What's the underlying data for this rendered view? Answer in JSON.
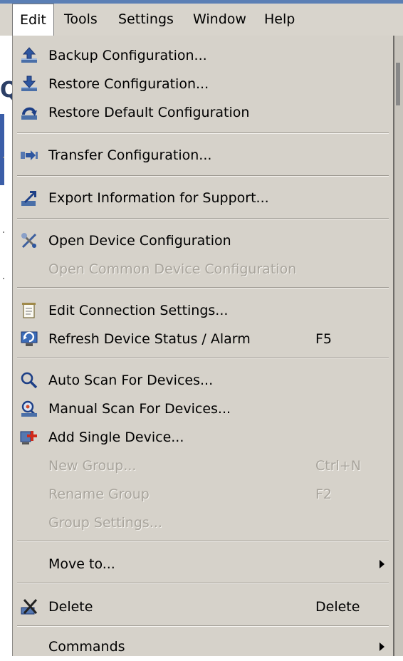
{
  "menubar": {
    "items": [
      "Edit",
      "Tools",
      "Settings",
      "Window",
      "Help"
    ]
  },
  "menu": {
    "items": [
      {
        "label": "Backup Configuration...",
        "icon": "backup-icon"
      },
      {
        "label": "Restore Configuration...",
        "icon": "restore-icon"
      },
      {
        "label": "Restore Default Configuration",
        "icon": "restore-default-icon"
      },
      {
        "label": "Transfer Configuration...",
        "icon": "transfer-icon"
      },
      {
        "label": "Export Information for Support...",
        "icon": "export-icon"
      },
      {
        "label": "Open Device Configuration",
        "icon": "tools-icon"
      },
      {
        "label": "Open Common Device Configuration",
        "disabled": true
      },
      {
        "label": "Edit Connection Settings...",
        "icon": "document-icon"
      },
      {
        "label": "Refresh Device Status / Alarm",
        "shortcut": "F5",
        "icon": "refresh-icon"
      },
      {
        "label": "Auto Scan For Devices...",
        "icon": "magnifier-icon"
      },
      {
        "label": "Manual Scan For Devices...",
        "icon": "manual-scan-icon"
      },
      {
        "label": "Add Single Device...",
        "icon": "add-device-icon"
      },
      {
        "label": "New Group...",
        "shortcut": "Ctrl+N",
        "disabled": true
      },
      {
        "label": "Rename Group",
        "shortcut": "F2",
        "disabled": true
      },
      {
        "label": "Group Settings...",
        "disabled": true
      },
      {
        "label": "Move to...",
        "submenu": true
      },
      {
        "label": "Delete",
        "shortcut": "Delete",
        "icon": "delete-icon"
      },
      {
        "label": "Commands",
        "submenu": true
      }
    ]
  }
}
